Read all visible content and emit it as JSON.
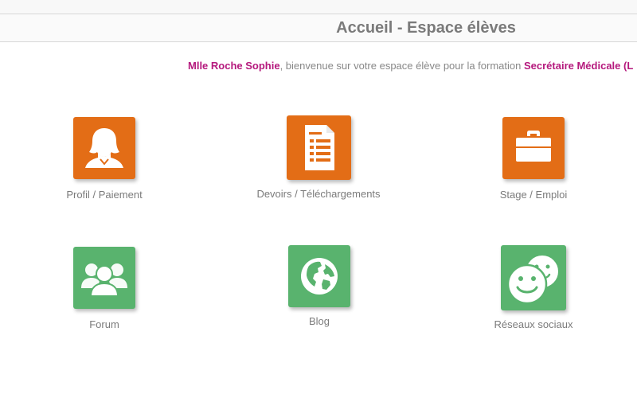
{
  "header": {
    "title": "Accueil - Espace élèves"
  },
  "welcome": {
    "name": "Mlle Roche Sophie",
    "text": ", bienvenue sur votre espace élève pour la formation ",
    "formation": "Secrétaire Médicale (L"
  },
  "tiles": [
    {
      "label": "Profil / Paiement",
      "color": "#e36d16",
      "icon": "user-female-icon"
    },
    {
      "label": "Devoirs / Téléchargements",
      "color": "#e36d16",
      "icon": "document-list-icon"
    },
    {
      "label": "Stage / Emploi",
      "color": "#e36d16",
      "icon": "briefcase-icon"
    },
    {
      "label": "Forum",
      "color": "#59b36e",
      "icon": "users-group-icon"
    },
    {
      "label": "Blog",
      "color": "#59b36e",
      "icon": "globe-icon"
    },
    {
      "label": "Réseaux sociaux",
      "color": "#59b36e",
      "icon": "smiley-faces-icon"
    }
  ],
  "colors": {
    "accent": "#b5197d",
    "orange": "#e36d16",
    "green": "#59b36e"
  }
}
